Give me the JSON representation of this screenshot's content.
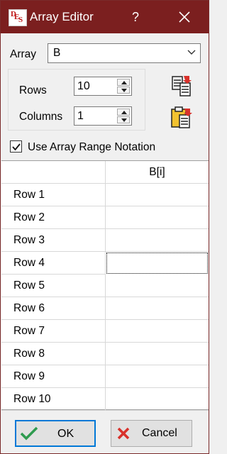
{
  "window": {
    "title": "Array Editor",
    "help_glyph": "?"
  },
  "array": {
    "label": "Array",
    "selected": "B"
  },
  "dimensions": {
    "rows_label": "Rows",
    "rows_value": "10",
    "columns_label": "Columns",
    "columns_value": "1"
  },
  "range_notation": {
    "label": "Use Array Range Notation",
    "checked": true
  },
  "grid": {
    "column_header": "B[i]",
    "rows": [
      "Row 1",
      "Row 2",
      "Row 3",
      "Row 4",
      "Row 5",
      "Row 6",
      "Row 7",
      "Row 8",
      "Row 9",
      "Row 10"
    ],
    "selected_row": "Row 4"
  },
  "buttons": {
    "ok_label": "OK",
    "cancel_label": "Cancel"
  },
  "colors": {
    "titlebar": "#7b1f1f",
    "ok_border": "#0078d7",
    "check_green": "#2e9b4f",
    "cancel_red": "#d8312b"
  }
}
